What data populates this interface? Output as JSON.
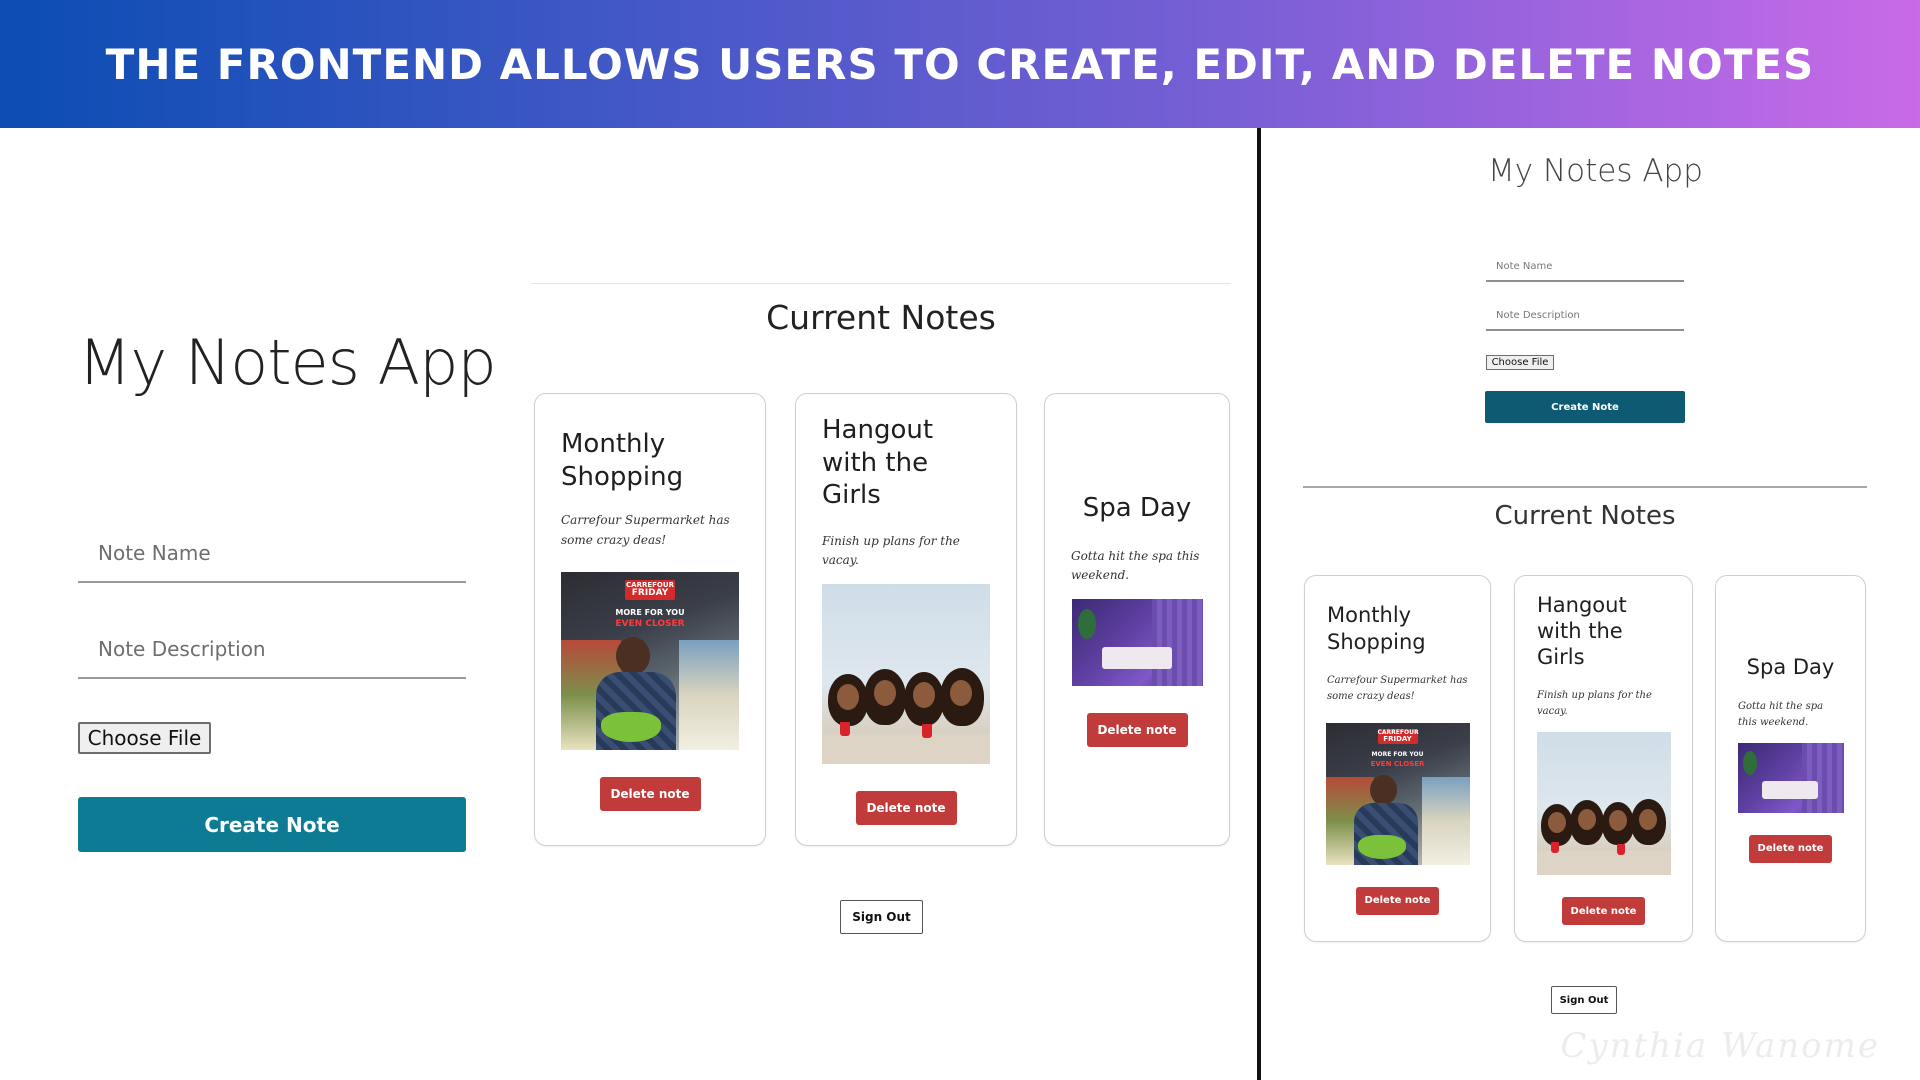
{
  "banner": {
    "title": "THE FRONTEND ALLOWS USERS TO CREATE, EDIT, AND DELETE NOTES"
  },
  "app": {
    "title": "My Notes App",
    "note_name_placeholder": "Note Name",
    "note_description_placeholder": "Note Description",
    "choose_file_label": "Choose File",
    "create_button": "Create Note",
    "section_title": "Current Notes",
    "sign_out_button": "Sign Out"
  },
  "notes": [
    {
      "title": "Monthly Shopping",
      "description": "Carrefour Supermarket has some crazy deas!",
      "delete_label": "Delete note",
      "image": {
        "sign_line1": "CARREFOUR",
        "sign_line2": "FRIDAY",
        "sign_sub": "MORE FOR YOU",
        "sign_red": "EVEN CLOSER"
      }
    },
    {
      "title": "Hangout with the Girls",
      "description": "Finish up plans for the vacay.",
      "delete_label": "Delete note"
    },
    {
      "title": "Spa Day",
      "description": "Gotta hit the spa this weekend.",
      "delete_label": "Delete note"
    }
  ],
  "watermark": "Cynthia Wanome",
  "colors": {
    "banner_start": "#0b4db3",
    "banner_end": "#c96ae8",
    "create_button": "#0c7b93",
    "create_button_small": "#0e5a73",
    "delete_button": "#c23b3b"
  }
}
